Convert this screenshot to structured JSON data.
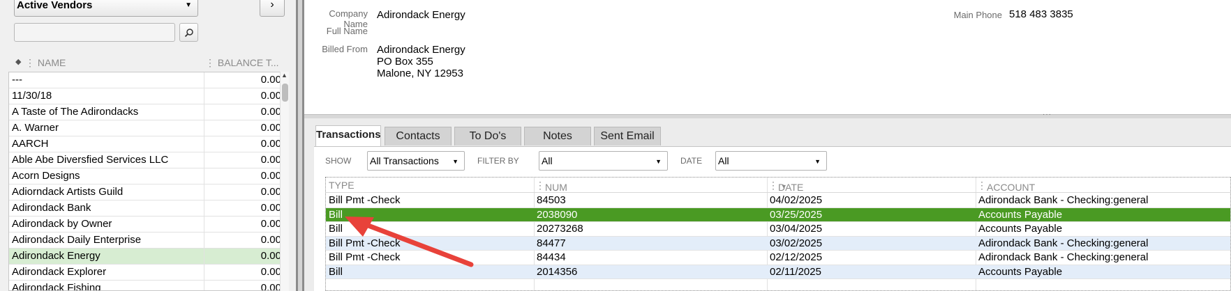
{
  "left": {
    "filter_label": "Active Vendors",
    "next_symbol": "›",
    "columns": {
      "name": "NAME",
      "balance": "BALANCE T..."
    },
    "vendors": [
      {
        "name": "---",
        "balance": "0.00"
      },
      {
        "name": "11/30/18",
        "balance": "0.00"
      },
      {
        "name": "A Taste of The Adirondacks",
        "balance": "0.00"
      },
      {
        "name": "A. Warner",
        "balance": "0.00"
      },
      {
        "name": "AARCH",
        "balance": "0.00"
      },
      {
        "name": "Able Abe Diversfied Services LLC",
        "balance": "0.00"
      },
      {
        "name": "Acorn Designs",
        "balance": "0.00"
      },
      {
        "name": "Adiorndack Artists Guild",
        "balance": "0.00"
      },
      {
        "name": "Adirondack Bank",
        "balance": "0.00"
      },
      {
        "name": "Adirondack by Owner",
        "balance": "0.00"
      },
      {
        "name": "Adirondack Daily Enterprise",
        "balance": "0.00"
      },
      {
        "name": "Adirondack Energy",
        "balance": "0.00"
      },
      {
        "name": "Adirondack Explorer",
        "balance": "0.00"
      },
      {
        "name": "Adirondack Fishing",
        "balance": "0.00"
      }
    ],
    "selected_index": 11
  },
  "info": {
    "company_name_label": "Company Name",
    "company_name": "Adirondack Energy",
    "full_name_label": "Full Name",
    "full_name": "",
    "billed_from_label": "Billed From",
    "billed_from": [
      "Adirondack Energy",
      "PO Box 355",
      "Malone, NY 12953"
    ],
    "main_phone_label": "Main Phone",
    "main_phone": "518 483 3835"
  },
  "tabs": [
    "Transactions",
    "Contacts",
    "To Do's",
    "Notes",
    "Sent Email"
  ],
  "filters": {
    "show_label": "SHOW",
    "show_value": "All Transactions",
    "filter_by_label": "FILTER BY",
    "filter_by_value": "All",
    "date_label": "DATE",
    "date_value": "All"
  },
  "grid": {
    "columns": [
      "TYPE",
      "NUM",
      "DATE",
      "ACCOUNT"
    ],
    "rows": [
      {
        "type": "Bill Pmt -Check",
        "num": "84503",
        "date": "04/02/2025",
        "account": "Adirondack Bank - Checking:general"
      },
      {
        "type": "Bill",
        "num": "2038090",
        "date": "03/25/2025",
        "account": "Accounts Payable"
      },
      {
        "type": "Bill",
        "num": "20273268",
        "date": "03/04/2025",
        "account": "Accounts Payable"
      },
      {
        "type": "Bill Pmt -Check",
        "num": "84477",
        "date": "03/02/2025",
        "account": "Adirondack Bank - Checking:general"
      },
      {
        "type": "Bill Pmt -Check",
        "num": "84434",
        "date": "02/12/2025",
        "account": "Adirondack Bank - Checking:general"
      },
      {
        "type": "Bill",
        "num": "2014356",
        "date": "02/11/2025",
        "account": "Accounts Payable"
      }
    ],
    "selected_index": 1
  },
  "colors": {
    "selected_row": "#4a9a23",
    "arrow": "#e8423a",
    "selected_vendor": "#d7edd2"
  }
}
